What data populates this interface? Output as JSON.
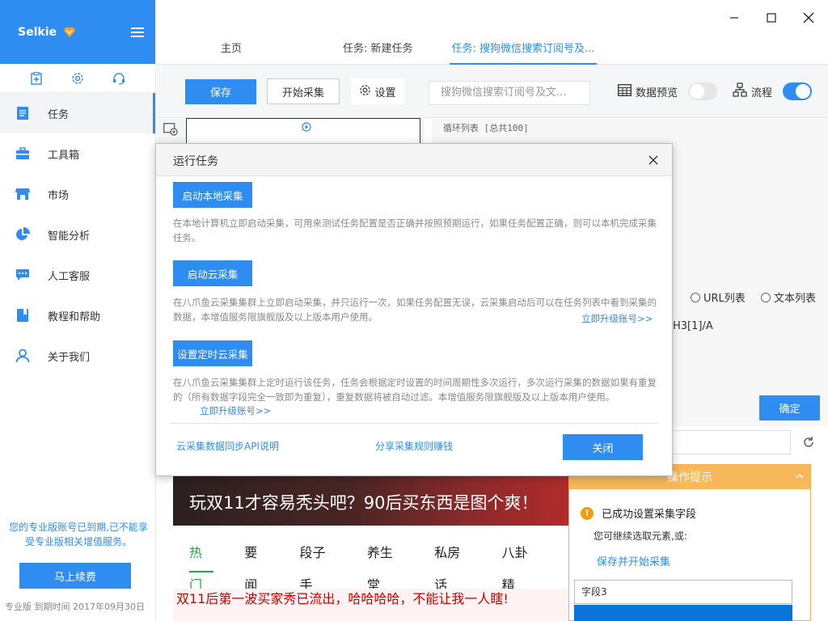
{
  "app": {
    "brand": "Selkie",
    "colors": {
      "accent": "#2f8cf1",
      "banner_red": "#b22b2b",
      "tip_orange": "#f6b85a",
      "news_green": "#27a34a"
    }
  },
  "sidebar": {
    "nav": [
      {
        "label": "任务",
        "icon": "task-icon"
      },
      {
        "label": "工具箱",
        "icon": "toolbox-icon"
      },
      {
        "label": "市场",
        "icon": "market-icon"
      },
      {
        "label": "智能分析",
        "icon": "pie-chart-icon"
      },
      {
        "label": "人工客服",
        "icon": "chat-icon"
      },
      {
        "label": "教程和帮助",
        "icon": "book-icon"
      },
      {
        "label": "关于我们",
        "icon": "user-icon"
      }
    ],
    "warning": "您的专业版账号已到期,已不能享受专业版相关增值服务。",
    "renew_label": "马上续费",
    "footer": "专业版  到期时间  2017年09月30日"
  },
  "tabs": [
    {
      "label": "主页"
    },
    {
      "label": "任务: 新建任务"
    },
    {
      "label": "任务: 搜狗微信搜索订阅号及..."
    }
  ],
  "toolbar": {
    "save_label": "保存",
    "start_label": "开始采集",
    "settings_label": "设置",
    "search_value": "搜狗微信搜索订阅号及文...",
    "preview_label": "数据预览",
    "flow_label": "流程"
  },
  "workarea": {
    "loop_label": "循环列表 [总共100]",
    "radio_url": "URL列表",
    "radio_text": "文本列表",
    "xpath_tail": "H3[1]/A",
    "ok_label": "确定"
  },
  "browser": {
    "banner_title": "玩双11才容易秃头吧？90后买东西是图个爽！",
    "news_tabs": [
      "热门",
      "要闻",
      "段子手",
      "养生堂",
      "私房话",
      "八卦精"
    ],
    "headline": "双11后第一波买家秀已流出，哈哈哈哈，不能让我一人瞎!"
  },
  "tips": {
    "title": "操作提示",
    "success": "已成功设置采集字段",
    "sub": "您可继续选取元素,或:",
    "link": "保存并开始采集",
    "field": "字段3"
  },
  "modal": {
    "title": "运行任务",
    "local_btn": "启动本地采集",
    "local_desc": "在本地计算机立即启动采集，可用来测试任务配置是否正确并按照预期运行，如果任务配置正确，则可以本机完成采集任务。",
    "cloud_btn": "启动云采集",
    "cloud_desc": "在八爪鱼云采集集群上立即启动采集，并只运行一次，如果任务配置无误，云采集启动后可以在任务列表中看到采集的数据，本增值服务限旗舰版及以上版本用户使用。",
    "upgrade_label": "立即升级账号>>",
    "timer_btn": "设置定时云采集",
    "timer_desc": "在八爪鱼云采集集群上定时运行该任务，任务会根据定时设置的时间周期性多次运行，多次运行采集的数据如果有重复的（所有数据字段完全一致即为重复），重复数据将被自动过滤。本增值服务限旗舰版及以上版本用户使用。",
    "api_link": "云采集数据同步API说明",
    "share_link": "分享采集规则赚钱",
    "close_label": "关闭"
  }
}
